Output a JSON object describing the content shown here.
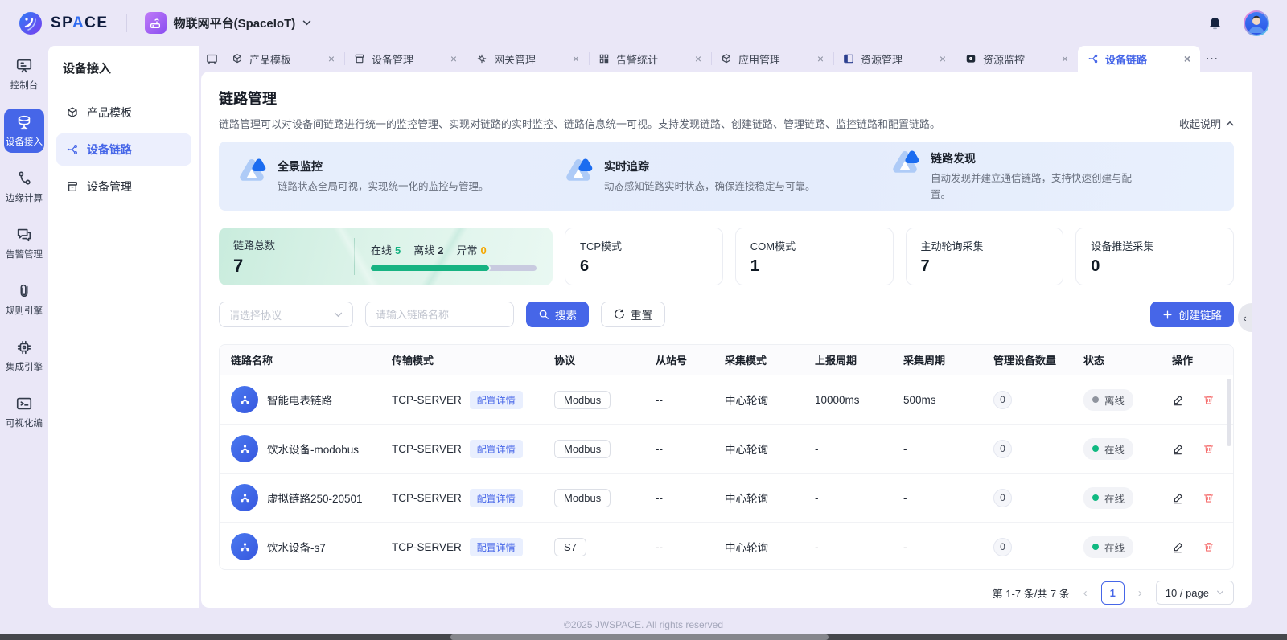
{
  "colors": {
    "accent": "#4666e8",
    "green": "#10b981",
    "orange": "#f5a700",
    "danger": "#f56c6c"
  },
  "header": {
    "logo": {
      "primary": "SP",
      "accent": "A",
      "secondary": "CE"
    },
    "workspace": "物联网平台(SpaceIoT)"
  },
  "nav_rail": {
    "items": [
      {
        "label": "控制台"
      },
      {
        "label": "设备接入"
      },
      {
        "label": "边缘计算"
      },
      {
        "label": "告警管理"
      },
      {
        "label": "规则引擎"
      },
      {
        "label": "集成引擎"
      },
      {
        "label": "可视化编"
      }
    ]
  },
  "sidebar": {
    "title": "设备接入",
    "items": [
      {
        "label": "产品模板"
      },
      {
        "label": "设备链路"
      },
      {
        "label": "设备管理"
      }
    ]
  },
  "tabs": {
    "more": "⋯",
    "close": "×",
    "items": [
      {
        "label": "产品模板"
      },
      {
        "label": "设备管理"
      },
      {
        "label": "网关管理"
      },
      {
        "label": "告警统计"
      },
      {
        "label": "应用管理"
      },
      {
        "label": "资源管理"
      },
      {
        "label": "资源监控"
      },
      {
        "label": "设备链路"
      }
    ]
  },
  "page": {
    "title": "链路管理",
    "description": "链路管理可以对设备间链路进行统一的监控管理、实现对链路的实时监控、链路信息统一可视。支持发现链路、创建链路、管理链路、监控链路和配置链路。",
    "collapse_label": "收起说明",
    "features": [
      {
        "title": "全景监控",
        "desc": "链路状态全局可视，实现统一化的监控与管理。"
      },
      {
        "title": "实时追踪",
        "desc": "动态感知链路实时状态，确保连接稳定与可靠。"
      },
      {
        "title": "链路发现",
        "desc": "自动发现并建立通信链路，支持快速创建与配置。"
      }
    ],
    "stats": {
      "total": {
        "label": "链路总数",
        "value": "7",
        "online_label": "在线",
        "online": "5",
        "offline_label": "离线",
        "offline": "2",
        "abnormal_label": "异常",
        "abnormal": "0",
        "bar_style": "width:71.4%"
      },
      "cards": [
        {
          "label": "TCP模式",
          "value": "6"
        },
        {
          "label": "COM模式",
          "value": "1"
        },
        {
          "label": "主动轮询采集",
          "value": "7"
        },
        {
          "label": "设备推送采集",
          "value": "0"
        }
      ]
    },
    "filter": {
      "protocol_placeholder": "请选择协议",
      "name_placeholder": "请输入链路名称",
      "search_label": "搜索",
      "reset_label": "重置",
      "create_label": "创建链路"
    },
    "table": {
      "columns": [
        "链路名称",
        "传输模式",
        "协议",
        "从站号",
        "采集模式",
        "上报周期",
        "采集周期",
        "管理设备数量",
        "状态",
        "操作"
      ],
      "config_tag": "配置详情",
      "rows": [
        {
          "name": "智能电表链路",
          "mode": "TCP-SERVER",
          "protocol": "Modbus",
          "station": "--",
          "collect": "中心轮询",
          "report": "10000ms",
          "period": "500ms",
          "devices": "0",
          "status": "离线",
          "status_type": "offline"
        },
        {
          "name": "饮水设备-modobus",
          "mode": "TCP-SERVER",
          "protocol": "Modbus",
          "station": "--",
          "collect": "中心轮询",
          "report": "-",
          "period": "-",
          "devices": "0",
          "status": "在线",
          "status_type": "online"
        },
        {
          "name": "虚拟链路250-20501",
          "mode": "TCP-SERVER",
          "protocol": "Modbus",
          "station": "--",
          "collect": "中心轮询",
          "report": "-",
          "period": "-",
          "devices": "0",
          "status": "在线",
          "status_type": "online"
        },
        {
          "name": "饮水设备-s7",
          "mode": "TCP-SERVER",
          "protocol": "S7",
          "station": "--",
          "collect": "中心轮询",
          "report": "-",
          "period": "-",
          "devices": "0",
          "status": "在线",
          "status_type": "online"
        }
      ]
    },
    "pagination": {
      "summary": "第 1-7 条/共 7 条",
      "page": "1",
      "page_size": "10 / page"
    }
  },
  "footer": {
    "copyright": "©2025 JWSPACE. All rights reserved"
  }
}
